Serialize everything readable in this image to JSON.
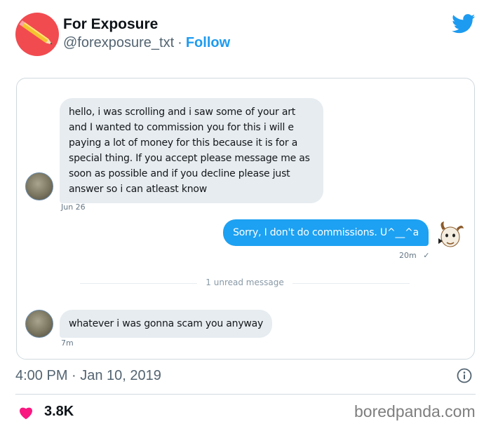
{
  "author": {
    "name": "For Exposure",
    "handle": "@forexposure_txt",
    "separator": "·",
    "follow_label": "Follow"
  },
  "dm": {
    "messages": [
      {
        "direction": "incoming",
        "text": "hello, i was scrolling and i saw some of your art and I wanted to commission you for this i will e paying a lot of money for this because it is for a special thing. If you accept please message me as soon as possible and if you decline please just answer so i can atleast know",
        "time": "Jun 26"
      },
      {
        "direction": "outgoing",
        "text": "Sorry, I don't do commissions.  U^__^a",
        "time": "20m",
        "status_glyph": "✓"
      },
      {
        "direction": "incoming",
        "text": "whatever i was gonna scam you anyway",
        "time": "7m"
      }
    ],
    "unread_label": "1 unread message"
  },
  "tweet": {
    "timestamp": "4:00 PM · Jan 10, 2019",
    "likes": "3.8K"
  },
  "watermark": "boredpanda.com",
  "colors": {
    "twitter_blue": "#1d9bf0",
    "dm_blue": "#1da1f2",
    "incoming_bubble": "#e6ecf0",
    "heart": "#f91880",
    "avatar_bg": "#f14b50"
  },
  "icons": [
    "pencil-avatar",
    "twitter-bird-icon",
    "info-icon",
    "heart-icon",
    "goat-avatar"
  ]
}
